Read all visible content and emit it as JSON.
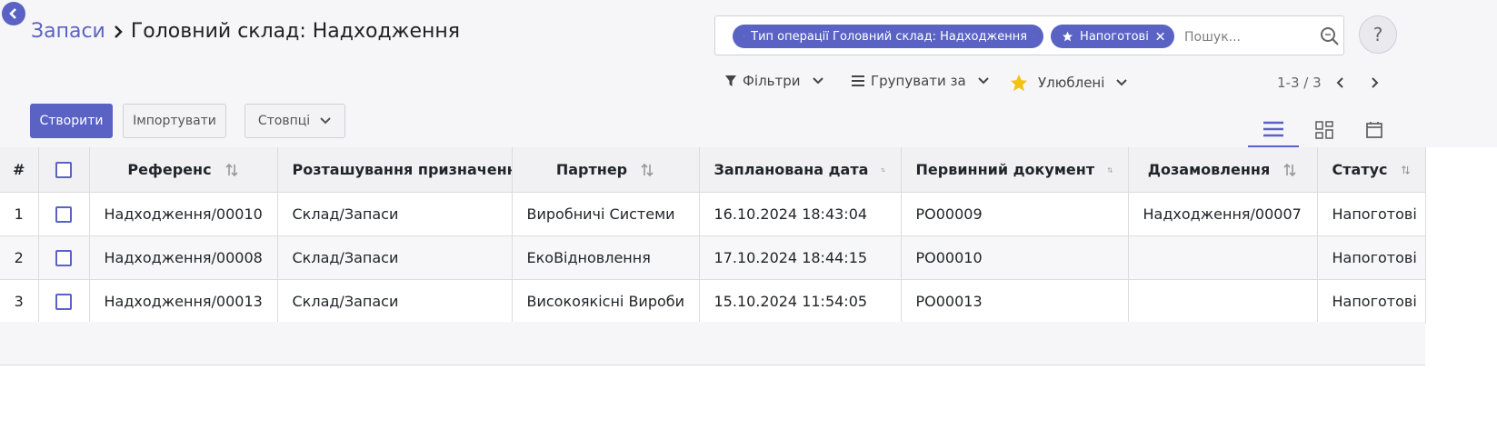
{
  "header": {
    "breadcrumb_parent": "Запаси",
    "breadcrumb_current": "Головний склад: Надходження"
  },
  "search": {
    "facets": [
      {
        "label": "Тип операції  Головний склад: Надходження"
      },
      {
        "label": "Напоготові"
      }
    ],
    "placeholder": "Пошук..."
  },
  "toolbar": {
    "filters_label": "Фільтри",
    "group_by_label": "Групувати за",
    "favorites_label": "Улюблені",
    "pager": "1-3 / 3",
    "create_label": "Створити",
    "import_label": "Імпортувати",
    "columns_label": "Стовпці"
  },
  "colors": {
    "accent": "#5a63c4",
    "favorite_star": "#f3c20f"
  },
  "icons": [
    "back-icon",
    "star-icon",
    "close-icon",
    "search-icon",
    "help-icon",
    "filter-icon",
    "group-icon",
    "chevron-down-icon",
    "chevron-left-icon",
    "chevron-right-icon",
    "list-view-icon",
    "kanban-view-icon",
    "calendar-view-icon",
    "sort-icon"
  ],
  "table": {
    "columns": [
      "#",
      "",
      "Референс",
      "Розташування призначення",
      "Партнер",
      "Запланована дата",
      "Первинний документ",
      "Дозамовлення",
      "Статус"
    ],
    "rows": [
      {
        "num": "1",
        "reference": "Надходження/00010",
        "destination": "Склад/Запаси",
        "partner": "Виробничі Системи",
        "date": "16.10.2024 18:43:04",
        "source": "PO00009",
        "backorder": "Надходження/00007",
        "status": "Напоготові"
      },
      {
        "num": "2",
        "reference": "Надходження/00008",
        "destination": "Склад/Запаси",
        "partner": "ЕкоВідновлення",
        "date": "17.10.2024 18:44:15",
        "source": "PO00010",
        "backorder": "",
        "status": "Напоготові"
      },
      {
        "num": "3",
        "reference": "Надходження/00013",
        "destination": "Склад/Запаси",
        "partner": "Високоякісні Вироби",
        "date": "15.10.2024 11:54:05",
        "source": "PO00013",
        "backorder": "",
        "status": "Напоготові"
      }
    ]
  }
}
